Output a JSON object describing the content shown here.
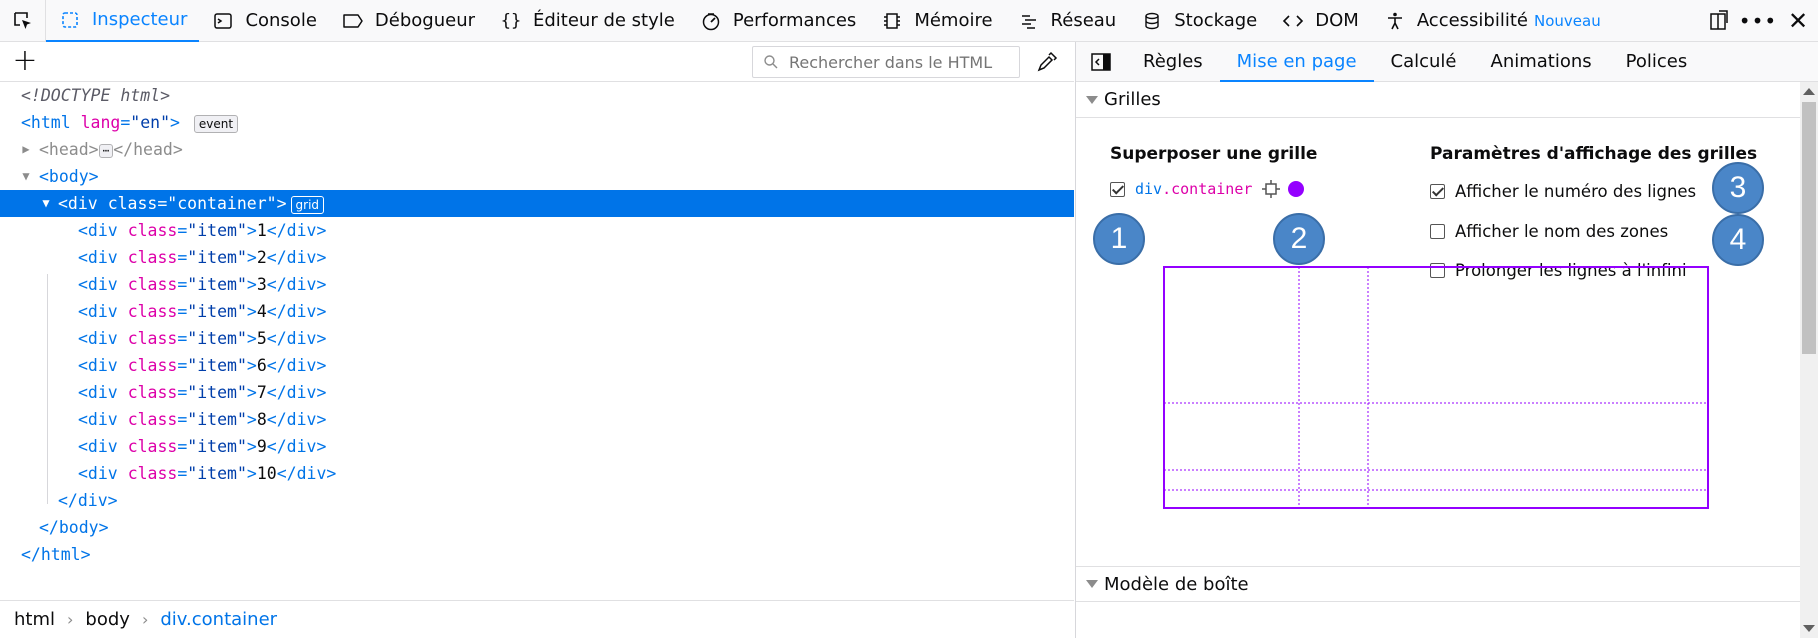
{
  "toolbar": {
    "tabs": [
      {
        "label": "Inspecteur",
        "icon": "inspector-icon",
        "active": true
      },
      {
        "label": "Console",
        "icon": "console-icon"
      },
      {
        "label": "Débogueur",
        "icon": "debugger-icon"
      },
      {
        "label": "Éditeur de style",
        "icon": "style-editor-icon"
      },
      {
        "label": "Performances",
        "icon": "performance-icon"
      },
      {
        "label": "Mémoire",
        "icon": "memory-icon"
      },
      {
        "label": "Réseau",
        "icon": "network-icon"
      },
      {
        "label": "Stockage",
        "icon": "storage-icon"
      },
      {
        "label": "DOM",
        "icon": "dom-icon"
      },
      {
        "label": "Accessibilité",
        "icon": "accessibility-icon"
      }
    ],
    "new_badge": "Nouveau"
  },
  "markup": {
    "search_placeholder": "Rechercher dans le HTML",
    "doctype": "<!DOCTYPE html>",
    "html_lang": "\"en\"",
    "event_badge": "event",
    "grid_badge": "grid",
    "container_class": "\"container\"",
    "item_class": "\"item\"",
    "items": [
      "1",
      "2",
      "3",
      "4",
      "5",
      "6",
      "7",
      "8",
      "9",
      "10"
    ]
  },
  "breadcrumbs": [
    "html",
    "body",
    "div.container"
  ],
  "sidebar": {
    "tabs": [
      "Règles",
      "Mise en page",
      "Calculé",
      "Animations",
      "Polices"
    ],
    "active_tab": "Mise en page",
    "grids_heading": "Grilles",
    "overlay_heading": "Superposer une grille",
    "overlay_item": {
      "tag": "div",
      "class": ".container",
      "checked": true,
      "color": "#9400ff"
    },
    "display_heading": "Paramètres d'affichage des grilles",
    "options": [
      {
        "label": "Afficher le numéro des lignes",
        "checked": true
      },
      {
        "label": "Afficher le nom des zones",
        "checked": false
      },
      {
        "label": "Prolonger les lignes à l'infini",
        "checked": false
      }
    ],
    "box_model_heading": "Modèle de boîte"
  },
  "callouts": [
    "1",
    "2",
    "3",
    "4"
  ],
  "colors": {
    "accent": "#0a84ff",
    "selection": "#0074e8",
    "grid_outline": "#9400ff",
    "callout": "#4a86c8"
  }
}
